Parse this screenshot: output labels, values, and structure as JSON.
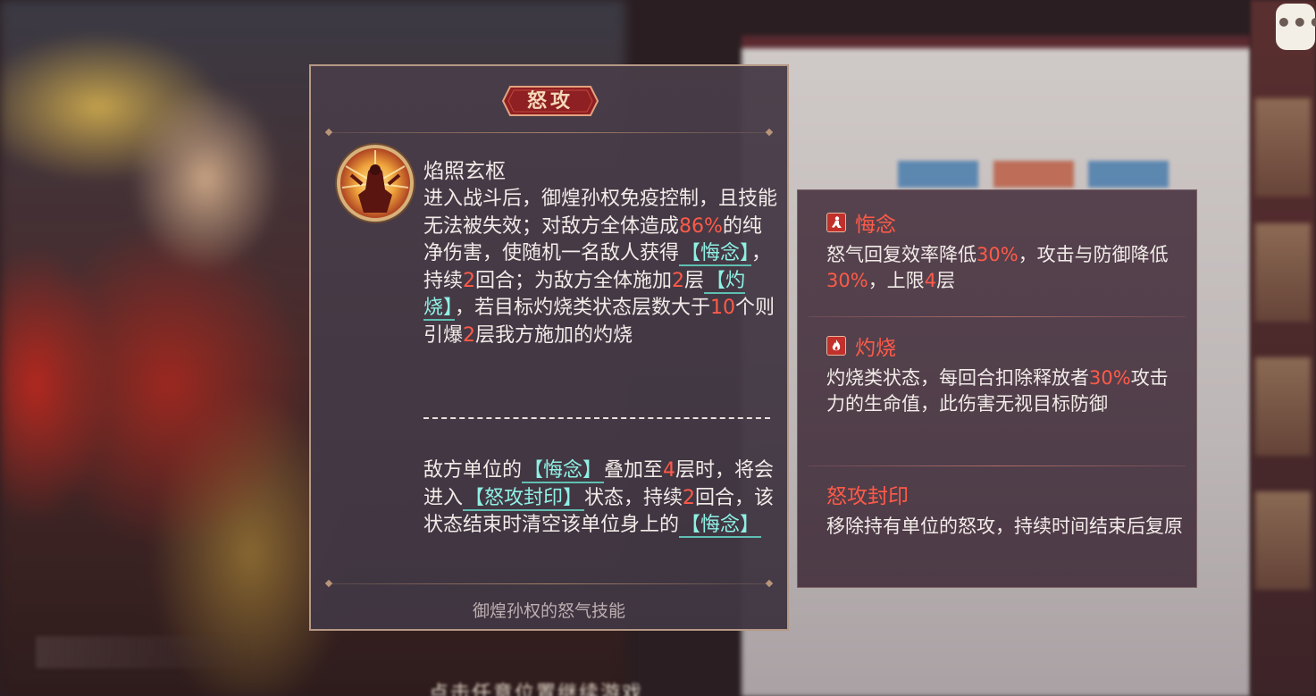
{
  "skill": {
    "category": "怒攻",
    "name": "焰照玄枢",
    "icon": "flame-warrior-icon",
    "desc_parts": {
      "p1": "进入战斗后，御煌孙权免疫控制，且技能无法被失效；对敌方全体造成",
      "n1": "86%",
      "p2": "的纯净伤害，使随机一名敌人获得",
      "tag1": "【悔念】",
      "p3": "，持续",
      "n2": "2",
      "p4": "回合；为敌方全体施加",
      "n3": "2",
      "p5": "层",
      "tag2": "【灼烧】",
      "p6": "，若目标灼烧类状态层数大于",
      "n4": "10",
      "p7": "个则引爆",
      "n5": "2",
      "p8": "层我方施加的灼烧"
    },
    "divider": "-------------------------",
    "extra_parts": {
      "p1": "敌方单位的",
      "tag1": "【悔念】",
      "p2": "叠加至",
      "n1": "4",
      "p3": "层时，将会进入",
      "tag2": "【怒攻封印】",
      "p4": "状态，持续",
      "n2": "2",
      "p5": "回合，该状态结束时清空该单位身上的",
      "tag3": "【悔念】"
    },
    "footer": "御煌孙权的怒气技能"
  },
  "keywords": [
    {
      "title": "悔念",
      "icon": "kneeling-figure-icon",
      "parts": {
        "p1": "怒气回复效率降低",
        "n1": "30%",
        "p2": "，攻击与防御降低",
        "n2": "30%",
        "p3": "，上限",
        "n3": "4",
        "p4": "层"
      }
    },
    {
      "title": "灼烧",
      "icon": "fire-icon",
      "parts": {
        "p1": "灼烧类状态，每回合扣除释放者",
        "n1": "30%",
        "p2": "攻击力的生命值，此伤害无视目标防御"
      }
    },
    {
      "title": "怒攻封印",
      "parts": {
        "p1": "移除持有单位的怒攻，持续时间结束后复原"
      }
    }
  ],
  "background": {
    "bottom_hint": "点击任意位置继续游戏",
    "chat_icon": "chat-bubble-icon"
  },
  "colors": {
    "highlight": "#ff5a48",
    "tag": "#8ff0e4",
    "text": "#f2ebe8"
  }
}
